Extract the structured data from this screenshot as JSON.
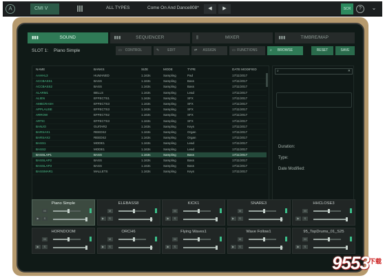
{
  "topbar": {
    "logo": "A",
    "instrument": "CMI V",
    "filter": "ALL TYPES",
    "preset": "Come On And Dance808*",
    "prev_label": "◀",
    "next_label": "▶",
    "green_btn": "SCR",
    "icons": [
      "arturia-logo-icon",
      "browser-bars-icon",
      "help-icon"
    ]
  },
  "tabs": [
    {
      "label": "SOUND",
      "icon": "bars-icon"
    },
    {
      "label": "SEQUENCER",
      "icon": "bars-icon"
    },
    {
      "label": "MIXER",
      "icon": "mixer-icon"
    },
    {
      "label": "TIMBRE/MAP",
      "icon": "bars-icon"
    }
  ],
  "slot": {
    "label": "SLOT 1:",
    "name": "Piano Simple"
  },
  "subtabs": [
    "CONTROL",
    "EDIT",
    "ASSIGN",
    "FUNCTIONS",
    "BROWSE",
    "RESET",
    "SAVE"
  ],
  "columns": [
    "NAME",
    "BANKS",
    "SIZE",
    "MODE",
    "TYPE",
    "DATE MODIFIED"
  ],
  "rows": [
    [
      "AAHHL3",
      "HUMANED",
      "1.163s",
      "Sampling",
      "Pad",
      "17/11/2017"
    ],
    [
      "ACCBASS1",
      "BASS",
      "1.163s",
      "Sampling",
      "Bass",
      "17/11/2017"
    ],
    [
      "ACCBASS2",
      "BASS",
      "1.163s",
      "Sampling",
      "Bass",
      "17/11/2017"
    ],
    [
      "ALARM1",
      "BELLS",
      "1.163s",
      "Sampling",
      "Lead",
      "17/11/2017"
    ],
    [
      "ALIEN",
      "EFFECTS1",
      "1.163s",
      "Sampling",
      "SFX",
      "17/11/2017"
    ],
    [
      "AMBCRASH",
      "EFFECTS3",
      "1.163s",
      "Sampling",
      "SFX",
      "17/11/2017"
    ],
    [
      "APPLAUSE",
      "EFFECTS3",
      "1.163s",
      "Sampling",
      "SFX",
      "17/11/2017"
    ],
    [
      "ARROW",
      "EFFECTS2",
      "1.163s",
      "Sampling",
      "SFX",
      "17/11/2017"
    ],
    [
      "ARTIC",
      "EFFECTS3",
      "1.163s",
      "Sampling",
      "SFX",
      "17/11/2017"
    ],
    [
      "BANJO",
      "GUITAR2",
      "1.163s",
      "Sampling",
      "Keys",
      "17/11/2017"
    ],
    [
      "BARSAX1",
      "REEDS2",
      "1.163s",
      "Sampling",
      "Organ",
      "17/11/2017"
    ],
    [
      "BARSAX2",
      "REEDS2",
      "1.163s",
      "Sampling",
      "Organ",
      "17/11/2017"
    ],
    [
      "BASS1",
      "MODE1",
      "1.163s",
      "Sampling",
      "Lead",
      "17/11/2017"
    ],
    [
      "BASS2",
      "MODE1",
      "1.163s",
      "Sampling",
      "Lead",
      "17/11/2017"
    ],
    [
      "BASSLAP1",
      "BASS",
      "1.163s",
      "Sampling",
      "Bass",
      "17/11/2017"
    ],
    [
      "BASSLAP2",
      "BASS",
      "1.163s",
      "Sampling",
      "Bass",
      "17/11/2017"
    ],
    [
      "BASSLAP3",
      "BASS",
      "1.163s",
      "Sampling",
      "Bass",
      "17/11/2017"
    ],
    [
      "BASSMAR1",
      "MALLETS",
      "1.163s",
      "Sampling",
      "Keys",
      "17/11/2017"
    ]
  ],
  "selected_row": 14,
  "info": {
    "search_icon": "⌕",
    "close": "✕",
    "duration": "Duration:",
    "type": "Type:",
    "modified": "Date Modified:"
  },
  "pads": [
    "Piano Simple",
    "ELEBASS8",
    "KICK1",
    "SNARE3",
    "HHCLOSE3",
    "HORNDOOM",
    "ORCH6",
    "Flying Waves1",
    "Wave Follow1",
    "95_TopDrums_01_S25"
  ],
  "pad_buttons": {
    "m": "M",
    "play": "▶",
    "s": "S"
  },
  "watermark": {
    "text": "9553",
    "suffix": "下载"
  },
  "colors": {
    "accent": "#2f7a56",
    "name_green": "#4fc58f",
    "wave_green": "#3cbf8a"
  }
}
